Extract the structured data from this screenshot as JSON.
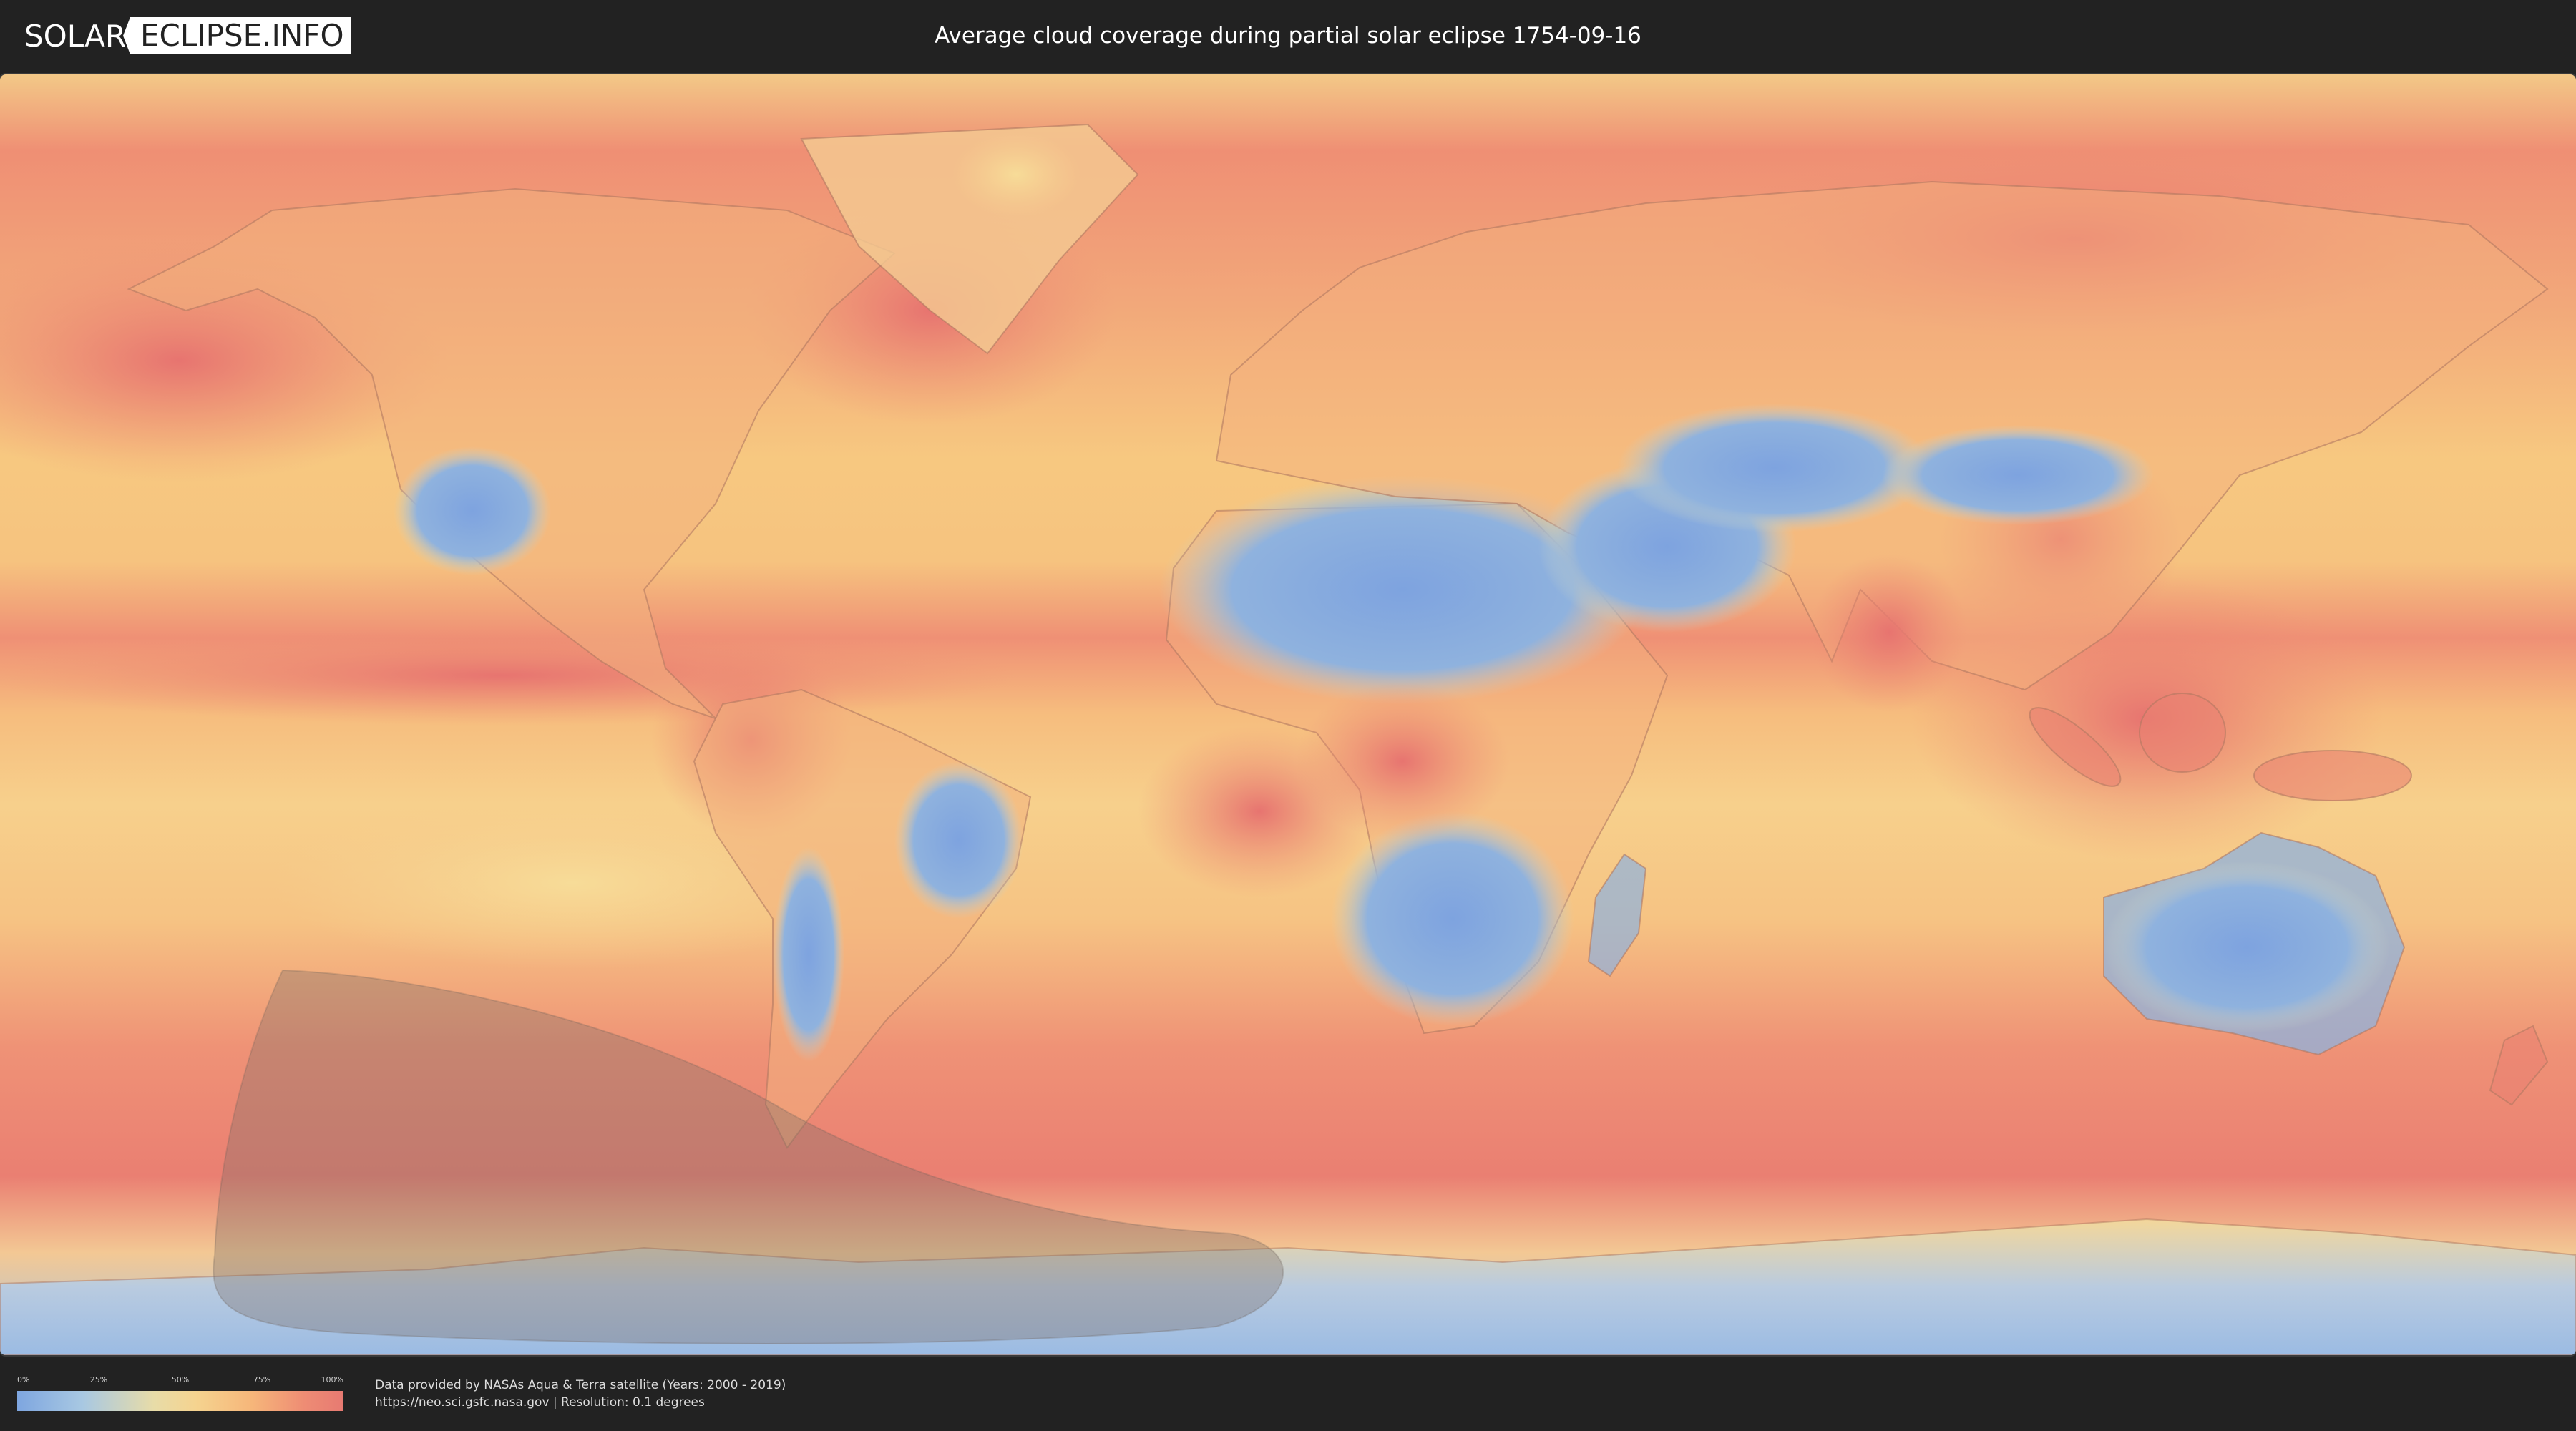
{
  "header": {
    "logo_left": "SOLAR",
    "logo_right": "ECLIPSE.INFO",
    "title": "Average cloud coverage during partial solar eclipse 1754-09-16"
  },
  "legend": {
    "ticks": [
      "0%",
      "25%",
      "50%",
      "75%",
      "100%"
    ],
    "colors": {
      "low": "#7ea6e0",
      "mid_low": "#a8c8e2",
      "mid": "#f5d38f",
      "mid_high": "#f6b67a",
      "high": "#e77a72"
    }
  },
  "footer": {
    "credit_line_1": "Data provided by NASAs Aqua & Terra satellite (Years: 2000 - 2019)",
    "credit_line_2": "https://neo.sci.gsfc.nasa.gov | Resolution: 0.1 degrees"
  },
  "map": {
    "background_color": "#f7c07c",
    "eclipse_shadow_color": "#8a7060"
  }
}
